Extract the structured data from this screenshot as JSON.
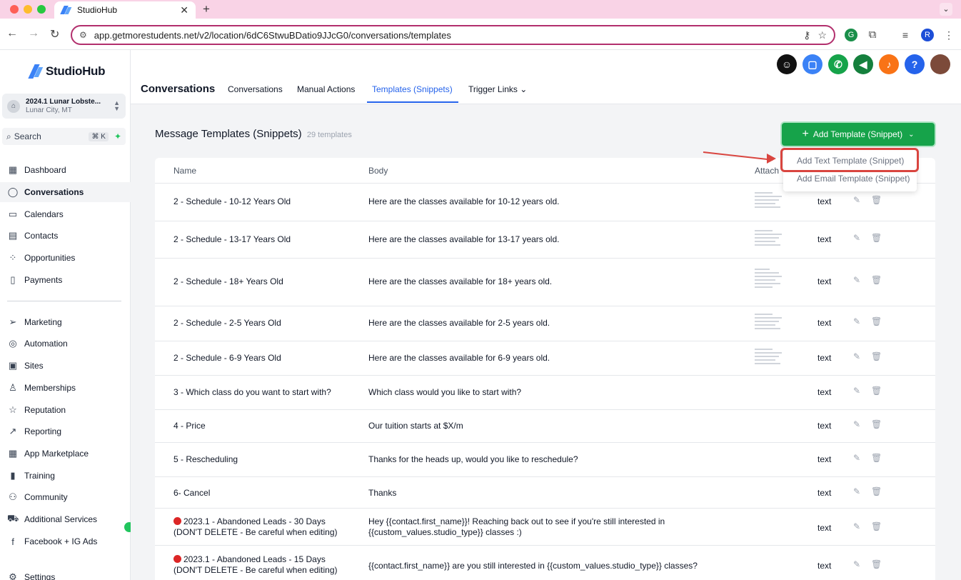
{
  "browser": {
    "tab_title": "StudioHub",
    "url": "app.getmorestudents.net/v2/location/6dC6StwuBDatio9JJcG0/conversations/templates",
    "profile_initial": "R"
  },
  "sidebar": {
    "brand": "StudioHub",
    "location_name": "2024.1 Lunar Lobste...",
    "location_sub": "Lunar City, MT",
    "search_label": "Search",
    "search_shortcut": "⌘ K",
    "items": [
      {
        "label": "Dashboard",
        "icon": "dashboard-icon"
      },
      {
        "label": "Conversations",
        "icon": "chat-icon",
        "active": true
      },
      {
        "label": "Calendars",
        "icon": "calendar-icon"
      },
      {
        "label": "Contacts",
        "icon": "contacts-icon"
      },
      {
        "label": "Opportunities",
        "icon": "opportunities-icon"
      },
      {
        "label": "Payments",
        "icon": "payments-icon"
      },
      {
        "label": "Marketing",
        "icon": "send-icon"
      },
      {
        "label": "Automation",
        "icon": "automation-icon"
      },
      {
        "label": "Sites",
        "icon": "sites-icon"
      },
      {
        "label": "Memberships",
        "icon": "memberships-icon"
      },
      {
        "label": "Reputation",
        "icon": "star-icon"
      },
      {
        "label": "Reporting",
        "icon": "reporting-icon"
      },
      {
        "label": "App Marketplace",
        "icon": "grid-icon"
      },
      {
        "label": "Training",
        "icon": "book-icon"
      },
      {
        "label": "Community",
        "icon": "community-icon"
      },
      {
        "label": "Additional Services",
        "icon": "cart-icon"
      },
      {
        "label": "Facebook + IG Ads",
        "icon": "facebook-icon"
      },
      {
        "label": "Settings",
        "icon": "gear-icon"
      }
    ]
  },
  "header": {
    "title": "Conversations",
    "tabs": [
      "Conversations",
      "Manual Actions",
      "Templates (Snippets)",
      "Trigger Links"
    ]
  },
  "main": {
    "section_title": "Message Templates (Snippets)",
    "count": "29 templates",
    "add_button": "Add Template (Snippet)",
    "dropdown": [
      "Add Text Template (Snippet)",
      "Add Email Template (Snippet)"
    ],
    "columns": [
      "Name",
      "Body",
      "Attach"
    ],
    "rows": [
      {
        "name": "2 - Schedule - 10-12 Years Old",
        "body": "Here are the classes available for 10-12 years old.",
        "type": "text"
      },
      {
        "name": "2 - Schedule - 13-17 Years Old",
        "body": "Here are the classes available for 13-17 years old.",
        "type": "text"
      },
      {
        "name": "2 - Schedule - 18+ Years Old",
        "body": "Here are the classes available for 18+ years old.",
        "type": "text"
      },
      {
        "name": "2 - Schedule - 2-5 Years Old",
        "body": "Here are the classes available for 2-5 years old.",
        "type": "text"
      },
      {
        "name": "2 - Schedule - 6-9 Years Old",
        "body": "Here are the classes available for 6-9 years old.",
        "type": "text"
      },
      {
        "name": "3 - Which class do you want to start with?",
        "body": "Which class would you like to start with?",
        "type": "text"
      },
      {
        "name": "4 - Price",
        "body": "Our tuition starts at $X/m",
        "type": "text"
      },
      {
        "name": "5 - Rescheduling",
        "body": "Thanks for the heads up, would you like to reschedule?",
        "type": "text"
      },
      {
        "name": "6- Cancel",
        "body": "Thanks",
        "type": "text"
      },
      {
        "name_line1": "2023.1 - Abandoned Leads - 30 Days",
        "name_line2": "(DON'T DELETE - Be careful when editing)",
        "body_line1": "Hey {{contact.first_name}}! Reaching back out to see if you're still interested in",
        "body_line2": "{{custom_values.studio_type}} classes :)",
        "type": "text"
      },
      {
        "name_line1": "2023.1 - Abandoned Leads - 15 Days",
        "name_line2": "(DON'T DELETE - Be careful when editing)",
        "body": "{{contact.first_name}} are you still interested in {{custom_values.studio_type}} classes?",
        "type": "text"
      }
    ]
  }
}
